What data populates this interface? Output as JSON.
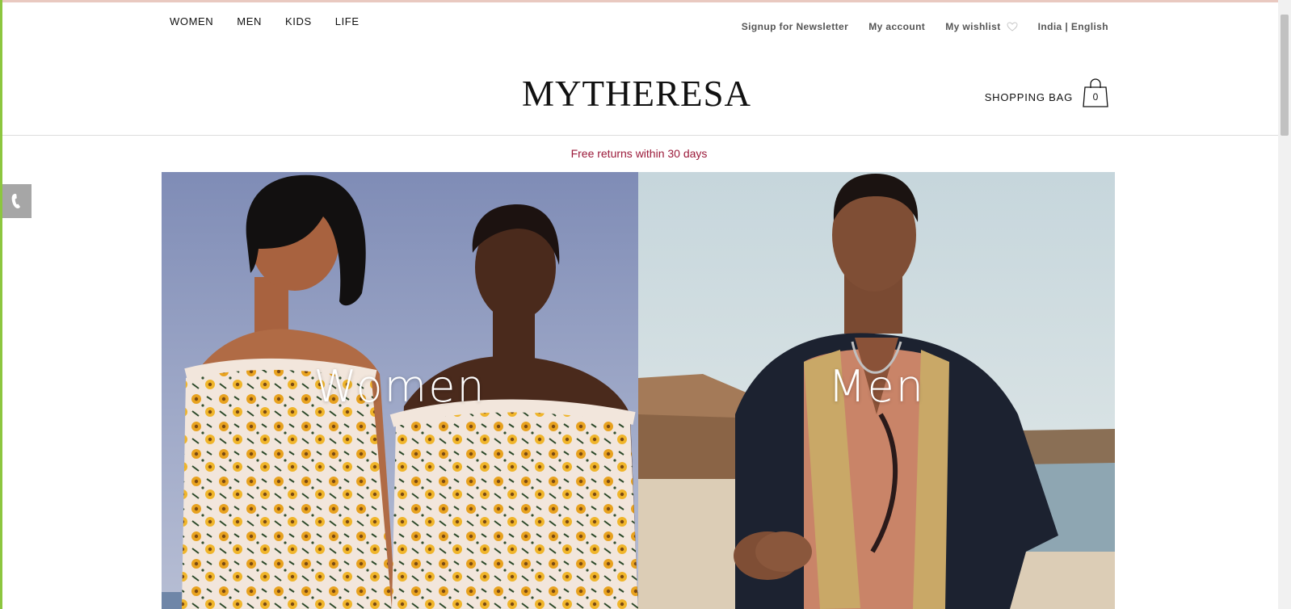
{
  "top_nav": {
    "women": "WOMEN",
    "men": "MEN",
    "kids": "KIDS",
    "life": "LIFE"
  },
  "utility_nav": {
    "newsletter": "Signup for Newsletter",
    "account": "My account",
    "wishlist": "My wishlist",
    "locale": "India | English"
  },
  "logo": "MYTHERESA",
  "bag": {
    "label": "SHOPPING BAG",
    "count": "0"
  },
  "promo": "Free returns within 30 days",
  "hero": {
    "women_label": "Women",
    "men_label": "Men"
  },
  "icons": {
    "phone": "phone-icon",
    "heart": "heart-icon",
    "bag": "shopping-bag-icon"
  },
  "colors": {
    "promo_text": "#9b1a3a",
    "side_tab": "#a6a6a6"
  }
}
